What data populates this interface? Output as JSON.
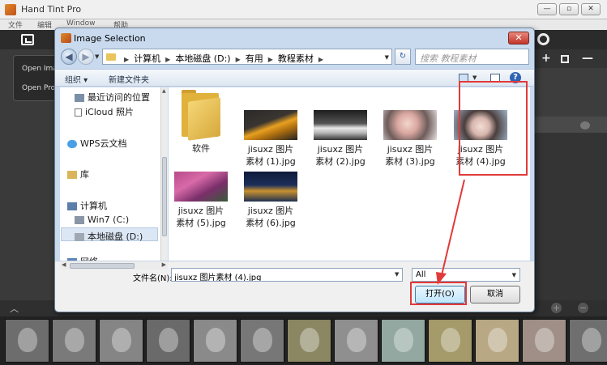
{
  "app": {
    "title": "Hand Tint Pro",
    "window_buttons": [
      "—",
      "▫",
      "✕"
    ],
    "menu": [
      "文件",
      "编辑",
      "Window",
      "帮助"
    ],
    "open_menu": [
      "Open Ima",
      "Open Pro"
    ],
    "right_panel": {
      "plus": "+",
      "minus": "—"
    },
    "bottom_bar": {
      "chevron": "︿",
      "plus": "+",
      "minus": "−"
    }
  },
  "dialog": {
    "title": "Image Selection",
    "close": "✕",
    "nav": {
      "back": "◀",
      "forward": "▶",
      "refresh": "↻"
    },
    "breadcrumbs": [
      "计算机",
      "本地磁盘 (D:)",
      "有用",
      "教程素材"
    ],
    "search_placeholder": "搜索 教程素材",
    "toolbar": {
      "organize": "组织 ▾",
      "new_folder": "新建文件夹",
      "help": "?"
    },
    "nav_pane": [
      {
        "label": "最近访问的位置",
        "icon": "recent-places-icon"
      },
      {
        "label": "iCloud 照片",
        "icon": "document-icon"
      },
      {
        "label": "WPS云文档",
        "icon": "cloud-icon"
      },
      {
        "label": "库",
        "icon": "library-icon"
      },
      {
        "label": "计算机",
        "icon": "computer-icon"
      },
      {
        "label": "Win7 (C:)",
        "icon": "drive-icon"
      },
      {
        "label": "本地磁盘 (D:)",
        "icon": "drive-icon"
      },
      {
        "label": "网络",
        "icon": "network-icon"
      }
    ],
    "files": [
      {
        "line1": "软件",
        "line2": ""
      },
      {
        "line1": "jisuxz 图片",
        "line2": "素材 (1).jpg"
      },
      {
        "line1": "jisuxz 图片",
        "line2": "素材 (2).jpg"
      },
      {
        "line1": "jisuxz 图片",
        "line2": "素材 (3).jpg"
      },
      {
        "line1": "jisuxz 图片",
        "line2": "素材 (4).jpg"
      },
      {
        "line1": "jisuxz 图片",
        "line2": "素材 (5).jpg"
      },
      {
        "line1": "jisuxz 图片",
        "line2": "素材 (6).jpg"
      }
    ],
    "file_name_label": "文件名(N):",
    "file_name_value": "jisuxz 图片素材 (4).jpg",
    "file_type": "All",
    "open_button": "打开(O)",
    "cancel_button": "取消"
  },
  "colors": {
    "annotation": "#e23a3a",
    "dialog_frame": "#c9daee",
    "selection": "#cfe1f5"
  }
}
